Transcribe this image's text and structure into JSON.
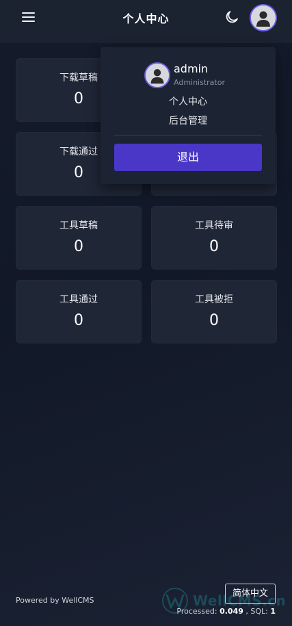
{
  "header": {
    "title": "个人中心",
    "menu_icon": "hamburger-menu-icon",
    "theme_icon": "moon-icon",
    "avatar_icon": "user-avatar-icon"
  },
  "cards": [
    {
      "label": "下载草稿",
      "value": "0"
    },
    {
      "label": "下载通过",
      "value": "0"
    },
    {
      "label": "工具草稿",
      "value": "0"
    },
    {
      "label": "工具待审",
      "value": "0"
    },
    {
      "label": "工具通过",
      "value": "0"
    },
    {
      "label": "工具被拒",
      "value": "0"
    }
  ],
  "dropdown": {
    "username": "admin",
    "role": "Administrator",
    "links": [
      "个人中心",
      "后台管理"
    ],
    "logout_label": "退出"
  },
  "footer": {
    "powered": "Powered by WellCMS",
    "language": "简体中文",
    "processed_label": "Processed:",
    "processed_value": "0.049",
    "sql_label": ", SQL:",
    "sql_value": "1",
    "watermark": "WellCMS.cn"
  },
  "colors": {
    "accent": "#4a36c7",
    "avatar_ring": "#6d5ce7",
    "card_bg": "#1f2636"
  }
}
